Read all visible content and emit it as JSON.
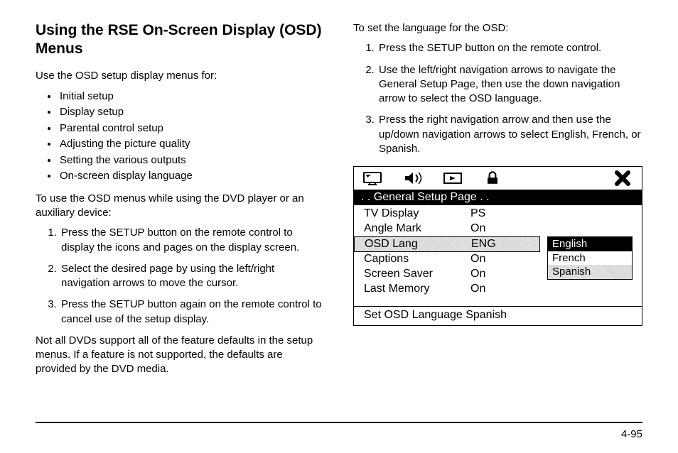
{
  "title": "Using the RSE On-Screen Display (OSD) Menus",
  "intro1": "Use the OSD setup display menus for:",
  "uses": [
    "Initial setup",
    "Display setup",
    "Parental control setup",
    "Adjusting the picture quality",
    "Setting the various outputs",
    "On-screen display language"
  ],
  "intro2": "To use the OSD menus while using the DVD player or an auxiliary device:",
  "steps_a": [
    "Press the SETUP button on the remote control to display the icons and pages on the display screen.",
    "Select the desired page by using the left/right navigation arrows to move the cursor.",
    "Press the SETUP button again on the remote control to cancel use of the setup display."
  ],
  "note": "Not all DVDs support all of the feature defaults in the setup menus. If a feature is not supported, the defaults are provided by the DVD media.",
  "intro3": "To set the language for the OSD:",
  "steps_b": [
    "Press the SETUP button on the remote control.",
    "Use the left/right navigation arrows to navigate the General Setup Page, then use the down navigation arrow to select the OSD language.",
    "Press the right navigation arrow and then use the up/down navigation arrows to select English, French, or Spanish."
  ],
  "osd": {
    "header": ". . General Setup Page . .",
    "rows": [
      {
        "label": "TV Display",
        "value": "PS"
      },
      {
        "label": "Angle Mark",
        "value": "On"
      },
      {
        "label": "OSD Lang",
        "value": "ENG"
      },
      {
        "label": "Captions",
        "value": "On"
      },
      {
        "label": "Screen Saver",
        "value": "On"
      },
      {
        "label": "Last Memory",
        "value": "On"
      }
    ],
    "submenu": [
      "English",
      "French",
      "Spanish"
    ],
    "status": "Set OSD Language Spanish"
  },
  "page_number": "4-95"
}
